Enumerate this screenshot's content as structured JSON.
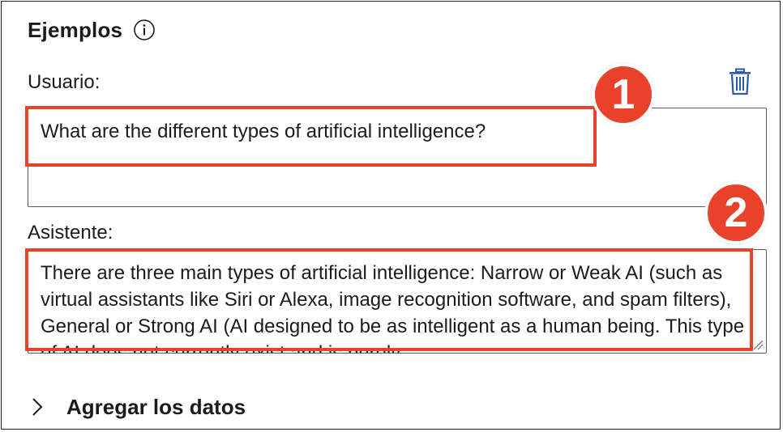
{
  "examples": {
    "title": "Ejemplos",
    "info_icon": "info-circle-icon"
  },
  "user": {
    "label": "Usuario:",
    "message": "What are the different types of artificial intelligence?",
    "delete_icon": "trash-icon"
  },
  "assistant": {
    "label": "Asistente:",
    "message": "There are three main types of artificial intelligence: Narrow or Weak AI (such as virtual assistants like Siri or Alexa, image recognition software, and spam filters), General or Strong AI (AI designed to be as intelligent as a human being. This type of AI does not currently exist and is purely"
  },
  "annotations": {
    "badge_1": "1",
    "badge_2": "2",
    "color": "#e8432a"
  },
  "add_data": {
    "label": "Agregar los datos",
    "icon": "chevron-right-icon"
  },
  "colors": {
    "accent_icon": "#2b5ba6",
    "annotation": "#e8432a",
    "text": "#1b1b1b"
  }
}
